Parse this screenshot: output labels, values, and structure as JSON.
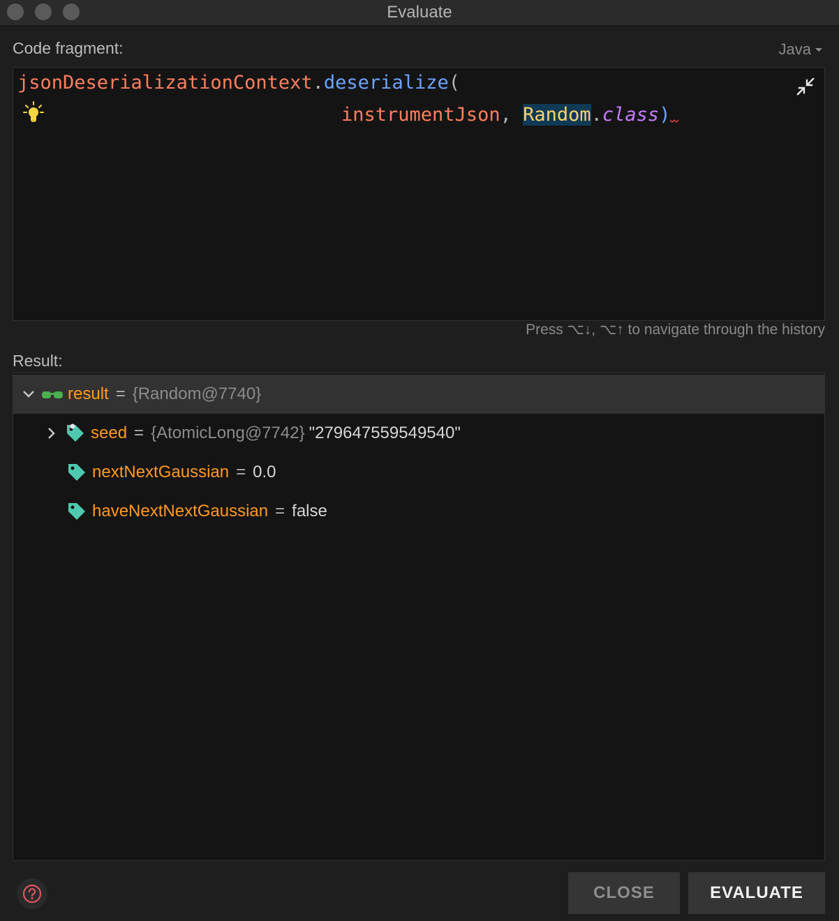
{
  "window": {
    "title": "Evaluate"
  },
  "labels": {
    "code_fragment": "Code fragment:",
    "result": "Result:"
  },
  "language": {
    "selected": "Java"
  },
  "code": {
    "line1": {
      "var": "jsonDeserializationContext",
      "dot": ".",
      "method": "deserialize",
      "paren": "("
    },
    "line2": {
      "arg": "instrumentJson",
      "comma": ", ",
      "class_name": "Random",
      "dot": ".",
      "keyword": "class",
      "close": ")"
    }
  },
  "history_hint": "Press ⌥↓, ⌥↑ to navigate through the history",
  "result_tree": {
    "root": {
      "name": "result",
      "eq": "=",
      "type": "{Random@7740}"
    },
    "children": [
      {
        "name": "seed",
        "eq": "=",
        "type": "{AtomicLong@7742}",
        "value": "\"279647559549540\""
      },
      {
        "name": "nextNextGaussian",
        "eq": "=",
        "value": "0.0"
      },
      {
        "name": "haveNextNextGaussian",
        "eq": "=",
        "value": "false"
      }
    ]
  },
  "buttons": {
    "close": "CLOSE",
    "evaluate": "EVALUATE"
  },
  "icons": {
    "window_controls": "traffic-light-icons",
    "intention": "lightbulb-icon",
    "collapse": "collapse-arrows-icon",
    "watch": "glasses-icon",
    "field": "tag-icon",
    "help": "question-circle-icon"
  },
  "colors": {
    "field_name": "#ff9a1f",
    "variable": "#ff7f5f",
    "method": "#6ea3ff",
    "class_name": "#ffd36b",
    "keyword": "#c77dff",
    "tag_icon": "#4ec9b0",
    "glasses_icon": "#4caf50",
    "help_icon": "#e05560"
  }
}
